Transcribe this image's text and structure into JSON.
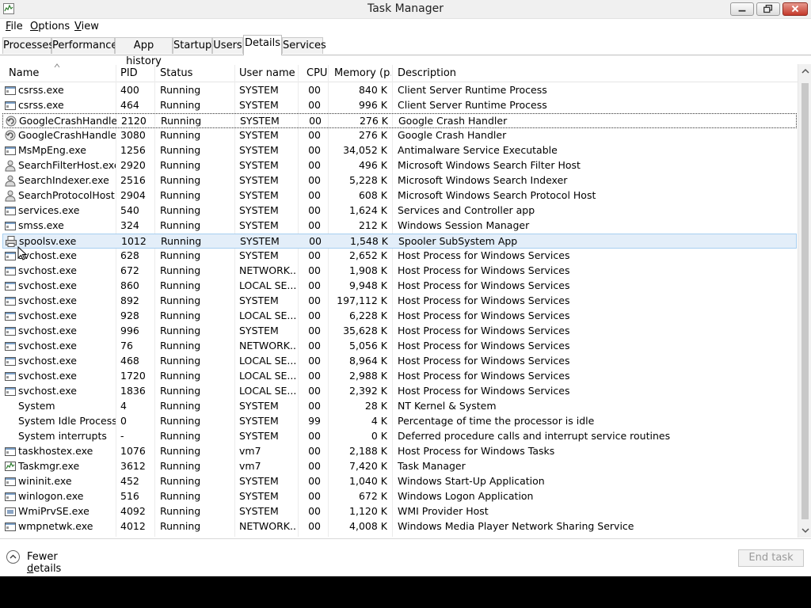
{
  "window": {
    "title": "Task Manager"
  },
  "menu": [
    {
      "label": "File",
      "mnemonic": "F",
      "rest": "ile"
    },
    {
      "label": "Options",
      "mnemonic": "O",
      "rest": "ptions"
    },
    {
      "label": "View",
      "mnemonic": "V",
      "rest": "iew"
    }
  ],
  "tabs": [
    "Processes",
    "Performance",
    "App history",
    "Startup",
    "Users",
    "Details",
    "Services"
  ],
  "active_tab": "Details",
  "columns": [
    "Name",
    "PID",
    "Status",
    "User name",
    "CPU",
    "Memory (p...",
    "Description"
  ],
  "rows": [
    {
      "name": "csrss.exe",
      "pid": "400",
      "status": "Running",
      "user": "SYSTEM",
      "cpu": "00",
      "mem": "840 K",
      "desc": "Client Server Runtime Process",
      "icon": "process-window-icon"
    },
    {
      "name": "csrss.exe",
      "pid": "464",
      "status": "Running",
      "user": "SYSTEM",
      "cpu": "00",
      "mem": "996 K",
      "desc": "Client Server Runtime Process",
      "icon": "process-window-icon"
    },
    {
      "name": "GoogleCrashHandler...",
      "pid": "2120",
      "status": "Running",
      "user": "SYSTEM",
      "cpu": "00",
      "mem": "276 K",
      "desc": "Google Crash Handler",
      "icon": "google-update-icon",
      "state": "focused"
    },
    {
      "name": "GoogleCrashHandler...",
      "pid": "3080",
      "status": "Running",
      "user": "SYSTEM",
      "cpu": "00",
      "mem": "276 K",
      "desc": "Google Crash Handler",
      "icon": "google-update-icon"
    },
    {
      "name": "MsMpEng.exe",
      "pid": "1256",
      "status": "Running",
      "user": "SYSTEM",
      "cpu": "00",
      "mem": "34,052 K",
      "desc": "Antimalware Service Executable",
      "icon": "process-window-icon"
    },
    {
      "name": "SearchFilterHost.exe",
      "pid": "2920",
      "status": "Running",
      "user": "SYSTEM",
      "cpu": "00",
      "mem": "496 K",
      "desc": "Microsoft Windows Search Filter Host",
      "icon": "search-person-icon"
    },
    {
      "name": "SearchIndexer.exe",
      "pid": "2516",
      "status": "Running",
      "user": "SYSTEM",
      "cpu": "00",
      "mem": "5,228 K",
      "desc": "Microsoft Windows Search Indexer",
      "icon": "search-person-icon"
    },
    {
      "name": "SearchProtocolHost....",
      "pid": "2904",
      "status": "Running",
      "user": "SYSTEM",
      "cpu": "00",
      "mem": "608 K",
      "desc": "Microsoft Windows Search Protocol Host",
      "icon": "search-person-icon"
    },
    {
      "name": "services.exe",
      "pid": "540",
      "status": "Running",
      "user": "SYSTEM",
      "cpu": "00",
      "mem": "1,624 K",
      "desc": "Services and Controller app",
      "icon": "process-window-icon"
    },
    {
      "name": "smss.exe",
      "pid": "324",
      "status": "Running",
      "user": "SYSTEM",
      "cpu": "00",
      "mem": "212 K",
      "desc": "Windows Session Manager",
      "icon": "process-window-icon"
    },
    {
      "name": "spoolsv.exe",
      "pid": "1012",
      "status": "Running",
      "user": "SYSTEM",
      "cpu": "00",
      "mem": "1,548 K",
      "desc": "Spooler SubSystem App",
      "icon": "printer-icon",
      "state": "selected"
    },
    {
      "name": "svchost.exe",
      "pid": "628",
      "status": "Running",
      "user": "SYSTEM",
      "cpu": "00",
      "mem": "2,652 K",
      "desc": "Host Process for Windows Services",
      "icon": "process-window-icon"
    },
    {
      "name": "svchost.exe",
      "pid": "672",
      "status": "Running",
      "user": "NETWORK...",
      "cpu": "00",
      "mem": "1,908 K",
      "desc": "Host Process for Windows Services",
      "icon": "process-window-icon"
    },
    {
      "name": "svchost.exe",
      "pid": "860",
      "status": "Running",
      "user": "LOCAL SE...",
      "cpu": "00",
      "mem": "9,948 K",
      "desc": "Host Process for Windows Services",
      "icon": "process-window-icon"
    },
    {
      "name": "svchost.exe",
      "pid": "892",
      "status": "Running",
      "user": "SYSTEM",
      "cpu": "00",
      "mem": "197,112 K",
      "desc": "Host Process for Windows Services",
      "icon": "process-window-icon"
    },
    {
      "name": "svchost.exe",
      "pid": "928",
      "status": "Running",
      "user": "LOCAL SE...",
      "cpu": "00",
      "mem": "6,228 K",
      "desc": "Host Process for Windows Services",
      "icon": "process-window-icon"
    },
    {
      "name": "svchost.exe",
      "pid": "996",
      "status": "Running",
      "user": "SYSTEM",
      "cpu": "00",
      "mem": "35,628 K",
      "desc": "Host Process for Windows Services",
      "icon": "process-window-icon"
    },
    {
      "name": "svchost.exe",
      "pid": "76",
      "status": "Running",
      "user": "NETWORK...",
      "cpu": "00",
      "mem": "5,056 K",
      "desc": "Host Process for Windows Services",
      "icon": "process-window-icon"
    },
    {
      "name": "svchost.exe",
      "pid": "468",
      "status": "Running",
      "user": "LOCAL SE...",
      "cpu": "00",
      "mem": "8,964 K",
      "desc": "Host Process for Windows Services",
      "icon": "process-window-icon"
    },
    {
      "name": "svchost.exe",
      "pid": "1720",
      "status": "Running",
      "user": "LOCAL SE...",
      "cpu": "00",
      "mem": "2,988 K",
      "desc": "Host Process for Windows Services",
      "icon": "process-window-icon"
    },
    {
      "name": "svchost.exe",
      "pid": "1836",
      "status": "Running",
      "user": "LOCAL SE...",
      "cpu": "00",
      "mem": "2,392 K",
      "desc": "Host Process for Windows Services",
      "icon": "process-window-icon"
    },
    {
      "name": "System",
      "pid": "4",
      "status": "Running",
      "user": "SYSTEM",
      "cpu": "00",
      "mem": "28 K",
      "desc": "NT Kernel & System",
      "icon": "none"
    },
    {
      "name": "System Idle Process",
      "pid": "0",
      "status": "Running",
      "user": "SYSTEM",
      "cpu": "99",
      "mem": "4 K",
      "desc": "Percentage of time the processor is idle",
      "icon": "none"
    },
    {
      "name": "System interrupts",
      "pid": "-",
      "status": "Running",
      "user": "SYSTEM",
      "cpu": "00",
      "mem": "0 K",
      "desc": "Deferred procedure calls and interrupt service routines",
      "icon": "none"
    },
    {
      "name": "taskhostex.exe",
      "pid": "1076",
      "status": "Running",
      "user": "vm7",
      "cpu": "00",
      "mem": "2,188 K",
      "desc": "Host Process for Windows Tasks",
      "icon": "process-window-icon"
    },
    {
      "name": "Taskmgr.exe",
      "pid": "3612",
      "status": "Running",
      "user": "vm7",
      "cpu": "00",
      "mem": "7,420 K",
      "desc": "Task Manager",
      "icon": "task-manager-icon"
    },
    {
      "name": "wininit.exe",
      "pid": "452",
      "status": "Running",
      "user": "SYSTEM",
      "cpu": "00",
      "mem": "1,040 K",
      "desc": "Windows Start-Up Application",
      "icon": "process-window-icon"
    },
    {
      "name": "winlogon.exe",
      "pid": "516",
      "status": "Running",
      "user": "SYSTEM",
      "cpu": "00",
      "mem": "672 K",
      "desc": "Windows Logon Application",
      "icon": "process-window-icon"
    },
    {
      "name": "WmiPrvSE.exe",
      "pid": "4092",
      "status": "Running",
      "user": "SYSTEM",
      "cpu": "00",
      "mem": "1,120 K",
      "desc": "WMI Provider Host",
      "icon": "wmi-icon"
    },
    {
      "name": "wmpnetwk.exe",
      "pid": "4012",
      "status": "Running",
      "user": "NETWORK...",
      "cpu": "00",
      "mem": "4,008 K",
      "desc": "Windows Media Player Network Sharing Service",
      "icon": "process-window-icon"
    }
  ],
  "footer": {
    "fewer_details": "Fewer details",
    "fewer_mnemonic": "d",
    "end_task": "End task"
  }
}
